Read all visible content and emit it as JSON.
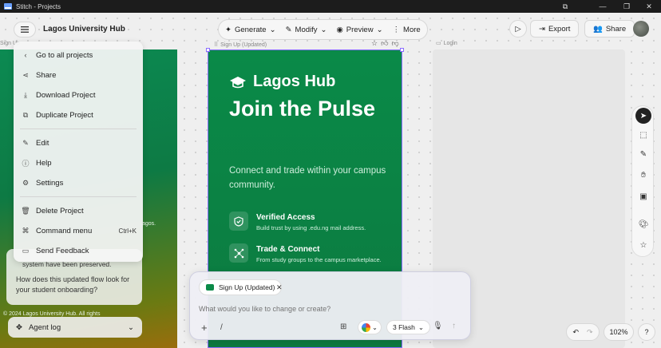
{
  "window": {
    "title": "Stitch - Projects"
  },
  "header": {
    "project_title": "Lagos University Hub",
    "generate": "Generate",
    "modify": "Modify",
    "preview": "Preview",
    "more": "More",
    "export": "Export",
    "share": "Share"
  },
  "frames": {
    "left_label": "Sign Up",
    "main_label": "Sign Up (Updated)",
    "login_label": "Login"
  },
  "screen": {
    "brand": "Lagos Hub",
    "headline": "Join the Pulse",
    "subtitle": "Connect and trade within your campus community.",
    "features": [
      {
        "title": "Verified Access",
        "desc": "Build trust by using .edu.ng mail address."
      },
      {
        "title": "Trade & Connect",
        "desc": "From study groups to the campus marketplace."
      }
    ]
  },
  "left_preview": {
    "fragment1": "agos.",
    "fragment2": "© 2024 Lagos University Hub. All rights"
  },
  "project_menu": {
    "items": [
      {
        "label": "Go to all projects",
        "icon": "chevron-left-icon"
      },
      {
        "label": "Share",
        "icon": "share-icon"
      },
      {
        "label": "Download Project",
        "icon": "download-icon"
      },
      {
        "label": "Duplicate Project",
        "icon": "duplicate-icon"
      },
      {
        "label": "Edit",
        "icon": "edit-icon"
      },
      {
        "label": "Help",
        "icon": "help-icon"
      },
      {
        "label": "Settings",
        "icon": "settings-icon"
      },
      {
        "label": "Delete Project",
        "icon": "trash-icon"
      },
      {
        "label": "Command menu",
        "icon": "command-icon",
        "shortcut": "Ctrl+K"
      },
      {
        "label": "Send Feedback",
        "icon": "feedback-icon"
      }
    ]
  },
  "chat": {
    "partial": "system have been preserved.",
    "message": "How does this updated flow look for your student onboarding?"
  },
  "agent_log": {
    "label": "Agent log"
  },
  "prompt": {
    "chip": "Sign Up (Updated)",
    "placeholder": "What would you like to change or create?",
    "slash": "/",
    "model": "3 Flash"
  },
  "zoom": {
    "value": "102%"
  },
  "colors": {
    "accent": "#8a6cff",
    "brand_green": "#0a8a48"
  }
}
